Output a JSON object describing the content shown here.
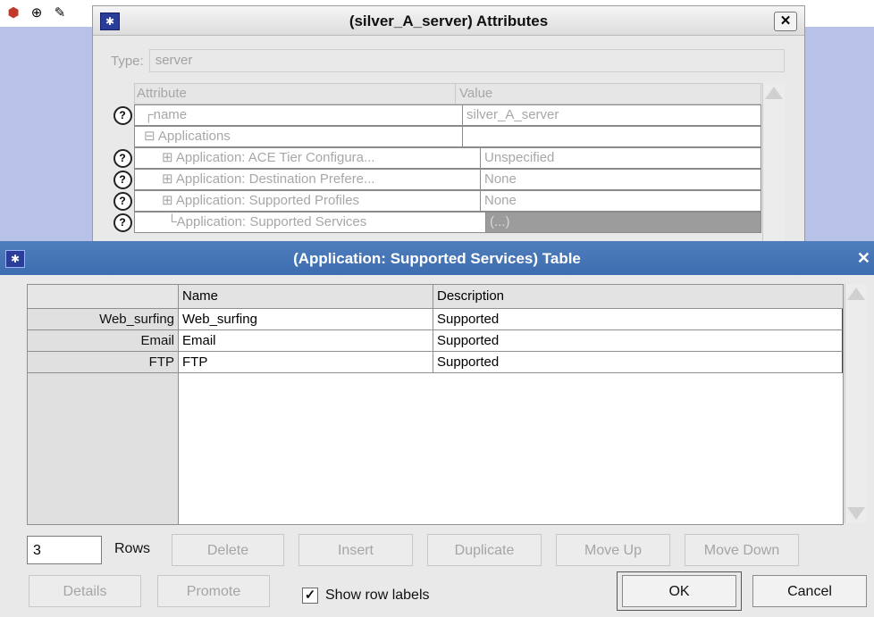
{
  "attr_window": {
    "title": "(silver_A_server) Attributes",
    "close": "✕",
    "type_label": "Type:",
    "type_value": "server",
    "col_attribute": "Attribute",
    "col_value": "Value",
    "rows": [
      {
        "name": "┌name",
        "value": "silver_A_server",
        "help": true
      },
      {
        "name": "⊟ Applications",
        "value": "",
        "help": false
      },
      {
        "name": "⊞ Application: ACE Tier Configura...",
        "value": "Unspecified",
        "help": true
      },
      {
        "name": "⊞ Application: Destination Prefere...",
        "value": "None",
        "help": true
      },
      {
        "name": "⊞ Application: Supported Profiles",
        "value": "None",
        "help": true
      },
      {
        "name": "└Application: Supported Services",
        "value": "(...)",
        "help": true
      }
    ]
  },
  "table_window": {
    "title": "(Application: Supported Services) Table",
    "close": "✕",
    "col_name": "Name",
    "col_description": "Description",
    "rows": [
      {
        "label": "Web_surfing",
        "name": "Web_surfing",
        "description": "Supported"
      },
      {
        "label": "Email",
        "name": "Email",
        "description": "Supported"
      },
      {
        "label": "FTP",
        "name": "FTP",
        "description": "Supported"
      }
    ],
    "rows_count": "3",
    "rows_label": "Rows",
    "buttons": {
      "delete": "Delete",
      "insert": "Insert",
      "duplicate": "Duplicate",
      "move_up": "Move Up",
      "move_down": "Move Down",
      "details": "Details",
      "promote": "Promote",
      "ok": "OK",
      "cancel": "Cancel"
    },
    "show_row_labels": "Show row labels",
    "show_row_labels_checked": true
  }
}
